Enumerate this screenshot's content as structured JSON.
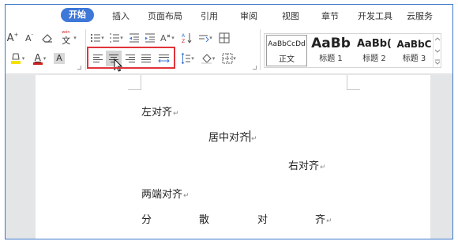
{
  "tabs": [
    {
      "label": "开始",
      "active": true
    },
    {
      "label": "插入"
    },
    {
      "label": "页面布局"
    },
    {
      "label": "引用"
    },
    {
      "label": "审阅"
    },
    {
      "label": "视图"
    },
    {
      "label": "章节"
    },
    {
      "label": "开发工具"
    },
    {
      "label": "云服务"
    }
  ],
  "ribbon": {
    "grow_font": "A",
    "shrink_font": "A",
    "font_color_letter": "A",
    "char_shading_letter": "A",
    "phonetic_char": "文",
    "accent_color": "#e0343a",
    "highlight_color": "#f5e100",
    "font_color": "#d02020"
  },
  "styles": [
    {
      "preview": "AaBbCcDd",
      "name": "正文"
    },
    {
      "preview": "AaBb",
      "name": "标题 1"
    },
    {
      "preview": "AaBb(",
      "name": "标题 2"
    },
    {
      "preview": "AaBbC",
      "name": "标题 3"
    }
  ],
  "document": {
    "lines": [
      {
        "text": "左对齐",
        "align": "left"
      },
      {
        "text": "居中对齐",
        "align": "center"
      },
      {
        "text": "右对齐",
        "align": "right"
      },
      {
        "text": "两端对齐",
        "align": "justify"
      },
      {
        "chars": [
          "分",
          "散",
          "对",
          "齐"
        ],
        "align": "distributed"
      }
    ],
    "paragraph_mark": "↵"
  }
}
